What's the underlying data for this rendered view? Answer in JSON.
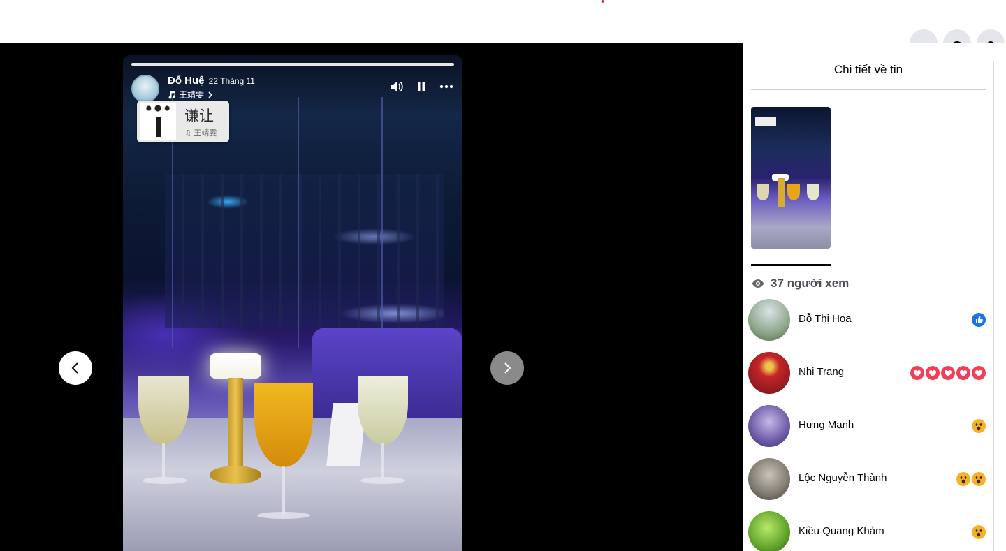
{
  "topbar": {
    "icons": [
      "apps-grid-icon",
      "messenger-icon",
      "notifications-bell-icon"
    ]
  },
  "story": {
    "author": "Đỗ Huệ",
    "date": "22 Tháng 11",
    "music": "王靖雯",
    "sticker": {
      "title": "谦让",
      "artist": "♫ 王靖雯"
    },
    "controls": [
      "volume-icon",
      "pause-icon",
      "more-options-icon"
    ]
  },
  "navigation": {
    "prev": "chevron-left-icon",
    "next": "chevron-right-icon"
  },
  "panel": {
    "title": "Chi tiết về tin",
    "views_label": "37 người xem",
    "viewers": [
      {
        "name": "Đỗ Thị Hoa",
        "reactions": [
          "like"
        ]
      },
      {
        "name": "Nhi Trang",
        "reactions": [
          "love",
          "love",
          "love",
          "love",
          "love"
        ]
      },
      {
        "name": "Hưng Mạnh",
        "reactions": [
          "wow"
        ]
      },
      {
        "name": "Lộc Nguyễn Thành",
        "reactions": [
          "wow",
          "wow"
        ]
      },
      {
        "name": "Kiều Quang Khảm",
        "reactions": [
          "wow"
        ]
      }
    ]
  },
  "colors": {
    "like": "#1b74e4",
    "love": "#f33e58",
    "wow": "#f7b125",
    "panel_text": "#050505"
  }
}
